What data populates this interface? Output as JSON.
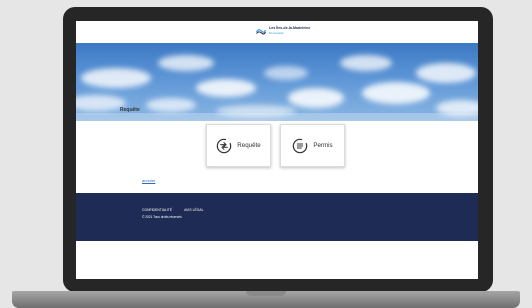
{
  "header": {
    "logo_title": "Les Îles-de-la-Madeleine",
    "logo_sub": "Municipalité"
  },
  "main": {
    "section_title": "Requête",
    "cards": [
      {
        "label": "Requête",
        "icon": "transfer-arrows-icon"
      },
      {
        "label": "Permis",
        "icon": "document-list-icon"
      }
    ],
    "link": "annuler"
  },
  "footer": {
    "links": [
      "Confidentialité",
      "Avis légal"
    ],
    "copyright": "© 2021 Tous droits réservés"
  },
  "colors": {
    "footer_bg": "#1e2b55",
    "sky": "#5d95d6",
    "link": "#2a6db8"
  }
}
